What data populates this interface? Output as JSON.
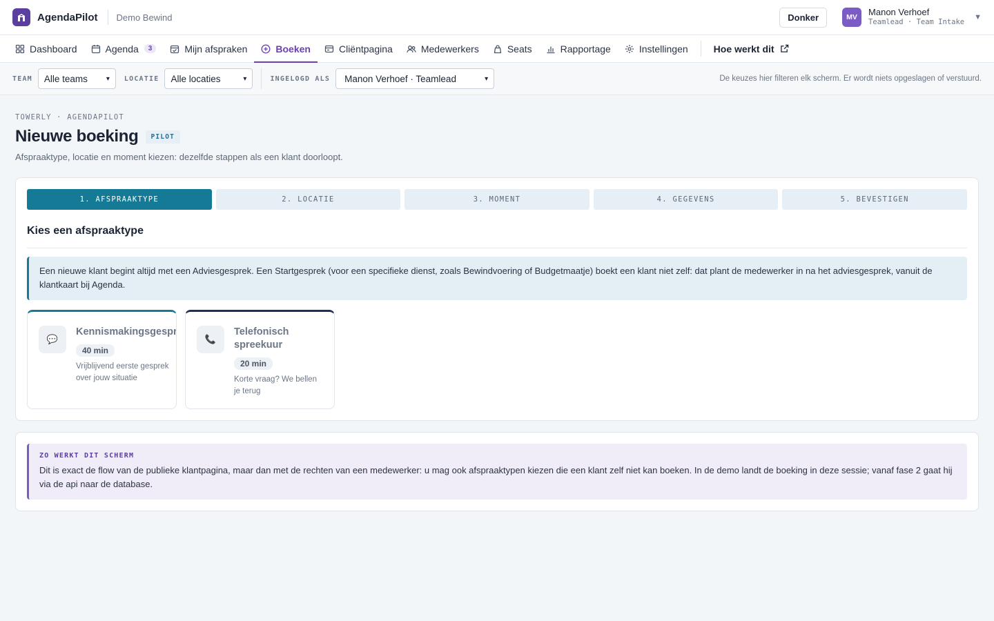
{
  "app": {
    "name": "AgendaPilot",
    "org": "Demo Bewind"
  },
  "header": {
    "theme_button": "Donker",
    "user": {
      "initials": "MV",
      "name": "Manon Verhoef",
      "role": "Teamlead · Team Intake"
    }
  },
  "nav": {
    "items": [
      {
        "label": "Dashboard",
        "icon": "grid-icon"
      },
      {
        "label": "Agenda",
        "icon": "calendar-icon",
        "badge": "3"
      },
      {
        "label": "Mijn afspraken",
        "icon": "calendar-check-icon"
      },
      {
        "label": "Boeken",
        "icon": "plus-circle-icon",
        "active": true
      },
      {
        "label": "Cliëntpagina",
        "icon": "window-icon"
      },
      {
        "label": "Medewerkers",
        "icon": "users-icon"
      },
      {
        "label": "Seats",
        "icon": "bag-icon"
      },
      {
        "label": "Rapportage",
        "icon": "bar-chart-icon"
      },
      {
        "label": "Instellingen",
        "icon": "gear-icon"
      }
    ],
    "help_link": "Hoe werkt dit"
  },
  "filters": {
    "team_label": "TEAM",
    "team_value": "Alle teams",
    "location_label": "LOCATIE",
    "location_value": "Alle locaties",
    "logged_in_label": "INGELOGD ALS",
    "logged_in_value": "Manon Verhoef · Teamlead",
    "note": "De keuzes hier filteren elk scherm. Er wordt niets opgeslagen of verstuurd."
  },
  "page": {
    "eyebrow": "TOWERLY · AGENDAPILOT",
    "title": "Nieuwe boeking",
    "badge": "PILOT",
    "subtitle": "Afspraaktype, locatie en moment kiezen: dezelfde stappen als een klant doorloopt."
  },
  "wizard": {
    "steps": [
      "1. AFSPRAAKTYPE",
      "2. LOCATIE",
      "3. MOMENT",
      "4. GEGEVENS",
      "5. BEVESTIGEN"
    ],
    "active_step": 0,
    "section_title": "Kies een afspraaktype",
    "info": "Een nieuwe klant begint altijd met een Adviesgesprek. Een Startgesprek (voor een specifieke dienst, zoals Bewindvoering of Budgetmaatje) boekt een klant niet zelf: dat plant de medewerker in na het adviesgesprek, vanuit de klantkaart bij Agenda.",
    "types": [
      {
        "name": "Kennismakingsgesprek",
        "duration": "40 min",
        "description": "Vrijblijvend eerste gesprek over jouw situatie",
        "icon": "chat-bubble-icon",
        "accent": "#157a95"
      },
      {
        "name": "Telefonisch spreekuur",
        "duration": "20 min",
        "description": "Korte vraag? We bellen je terug",
        "icon": "phone-icon",
        "accent": "#1d2f52"
      }
    ]
  },
  "help": {
    "title": "ZO WERKT DIT SCHERM",
    "text": "Dit is exact de flow van de publieke klantpagina, maar dan met de rechten van een medewerker: u mag ook afspraaktypen kiezen die een klant zelf niet kan boeken. In de demo landt de boeking in deze sessie; vanaf fase 2 gaat hij via de api naar de database."
  }
}
